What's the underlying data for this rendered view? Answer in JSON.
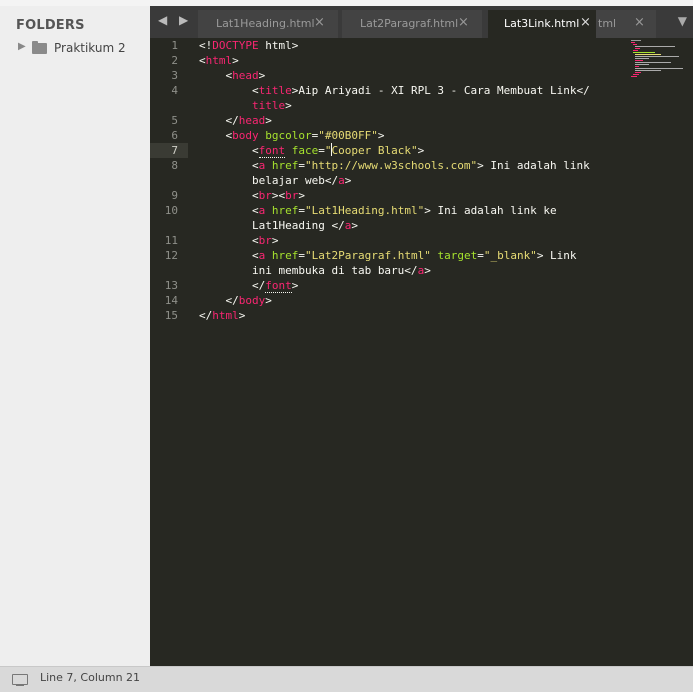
{
  "sidebar": {
    "title": "FOLDERS",
    "folders": [
      {
        "label": "Praktikum 2"
      }
    ]
  },
  "tabs": [
    {
      "label": "Lat1Heading.html"
    },
    {
      "label": "Lat2Paragraf.html"
    },
    {
      "label": "Lat3Link.html",
      "active": true
    },
    {
      "label": "tml"
    }
  ],
  "tab_close_glyph": "×",
  "nav_arrows": "◀ ▶",
  "overflow_glyph": "▼",
  "editor": {
    "current_line": 7,
    "line_numbers": [
      "1",
      "2",
      "3",
      "4",
      "",
      "5",
      "6",
      "7",
      "8",
      "",
      "9",
      "10",
      "",
      "11",
      "12",
      "",
      "13",
      "14",
      "15"
    ],
    "code": {
      "l1_doctype": "DOCTYPE",
      "l1_html": "html",
      "l2": "html",
      "l3": "head",
      "l4a": "title",
      "l4_text": "Aip Ariyadi - XI RPL 3 - Cara Membuat Link</",
      "l4b": "title",
      "l5": "head",
      "l6_tag": "body",
      "l6_attr": "bgcolor",
      "l6_val": "\"#00B0FF\"",
      "l7_tag": "font",
      "l7_attr": "face",
      "l7_q": "\"",
      "l7_val": "Cooper Black\"",
      "l8_tag": "a",
      "l8_attr": "href",
      "l8_val": "\"http://www.w3schools.com\"",
      "l8_text": " Ini adalah link",
      "l8b_text": "belajar web</",
      "l8b_tag": "a",
      "l9_br1": "br",
      "l9_br2": "br",
      "l10_tag": "a",
      "l10_attr": "href",
      "l10_val": "\"Lat1Heading.html\"",
      "l10_text": " Ini adalah link ke",
      "l10b_text": "Lat1Heading </",
      "l10b_tag": "a",
      "l11": "br",
      "l12_tag": "a",
      "l12_attr": "href",
      "l12_val": "\"Lat2Paragraf.html\"",
      "l12_attr2": "target",
      "l12_val2": "\"_blank\"",
      "l12_text": " Link",
      "l12b_text": "ini membuka di tab baru</",
      "l12b_tag": "a",
      "l13": "font",
      "l14": "body",
      "l15": "html"
    }
  },
  "status": {
    "text": "Line 7, Column 21"
  },
  "colors": {
    "editor_bg": "#272822",
    "tag": "#f92672",
    "attr": "#a6e22e",
    "string": "#e6db74",
    "text": "#f8f8f2"
  }
}
